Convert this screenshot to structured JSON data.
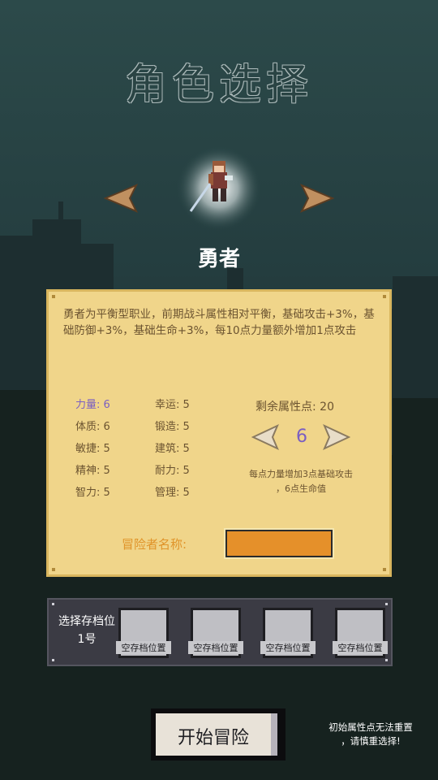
{
  "title": "角色选择",
  "hero": {
    "name": "勇者"
  },
  "description": "勇者为平衡型职业，前期战斗属性相对平衡，基础攻击+3%，基础防御+3%，基础生命+3%，每10点力量额外增加1点攻击",
  "stats_left": [
    {
      "label": "力量: 6",
      "highlight": true
    },
    {
      "label": "体质: 6",
      "highlight": false
    },
    {
      "label": "敏捷: 5",
      "highlight": false
    },
    {
      "label": "精神: 5",
      "highlight": false
    },
    {
      "label": "智力: 5",
      "highlight": false
    }
  ],
  "stats_right": [
    {
      "label": "幸运: 5"
    },
    {
      "label": "锻造: 5"
    },
    {
      "label": "建筑: 5"
    },
    {
      "label": "耐力: 5"
    },
    {
      "label": "管理: 5"
    }
  ],
  "remaining_points": "剩余属性点: 20",
  "allocation_value": "6",
  "stat_hint_line1": "每点力量增加3点基础攻击",
  "stat_hint_line2": "，6点生命值",
  "name_label": "冒险者名称:",
  "name_value": "",
  "save": {
    "label_line1": "选择存档位",
    "label_line2": "1号",
    "slots": [
      "空存档位置",
      "空存档位置",
      "空存档位置",
      "空存档位置"
    ]
  },
  "start_button": "开始冒险",
  "warning_line1": "初始属性点无法重置",
  "warning_line2": "，请慎重选择!",
  "colors": {
    "panel": "#f0d58a",
    "highlight_stat": "#7a5ec2",
    "name_input": "#e5902a",
    "save_panel": "#3b3b44"
  }
}
